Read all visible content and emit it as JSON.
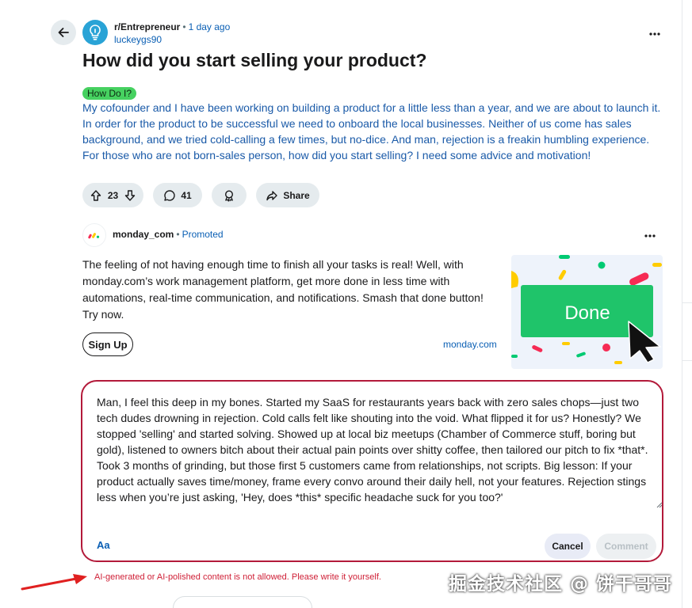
{
  "post": {
    "subreddit": "r/Entrepreneur",
    "time_ago": "1 day ago",
    "author": "luckeygs90",
    "title": "How did you start selling your product?",
    "flair": "How Do I?",
    "body": "My cofounder and I have been working on building a product for a little less than a year, and we are about to launch it. In order for the product to be successful we need to onboard the local businesses. Neither of us come has sales background, and we tried cold-calling a few times, but no-dice. And man, rejection is a freakin humbling experience. For those who are not born-sales person, how did you start selling? I need some advice and motivation!",
    "upvotes": "23",
    "comments": "41",
    "share_label": "Share",
    "flair_color": "#46d160"
  },
  "ad": {
    "advertiser": "monday_com",
    "promoted_label": "Promoted",
    "text": "The feeling of not having enough time to finish all your tasks is real! Well, with monday.com’s work management platform, get more done in less time with automations, real-time communication, and notifications. Smash that done button! Try now.",
    "cta": "Sign Up",
    "domain": "monday.com",
    "image_button_label": "Done"
  },
  "composer": {
    "text": "Man, I feel this deep in my bones. Started my SaaS for restaurants years back with zero sales chops—just two tech dudes drowning in rejection. Cold calls felt like shouting into the void. What flipped it for us? Honestly? We stopped 'selling' and started solving. Showed up at local biz meetups (Chamber of Commerce stuff, boring but gold), listened to owners bitch about their actual pain points over shitty coffee, then tailored our pitch to fix *that*. Took 3 months of grinding, but those first 5 customers came from relationships, not scripts. Big lesson: If your product actually saves time/money, frame every convo around their daily hell, not your features. Rejection stings less when you’re just asking, 'Hey, does *this* specific headache suck for you too?'",
    "format_label": "Aa",
    "cancel_label": "Cancel",
    "comment_label": "Comment",
    "error": "AI-generated or AI-polished content is not allowed. Please write it yourself.",
    "border_color": "#b31a3a"
  },
  "watermark": "掘金技术社区 @ 饼干哥哥",
  "icons": {
    "back": "arrow-left-icon",
    "subreddit": "lightbulb-icon",
    "more": "more-horizontal-icon",
    "upvote": "arrow-up-icon",
    "downvote": "arrow-down-icon",
    "comments": "speech-bubble-icon",
    "award": "award-icon",
    "share": "share-arrow-icon"
  }
}
